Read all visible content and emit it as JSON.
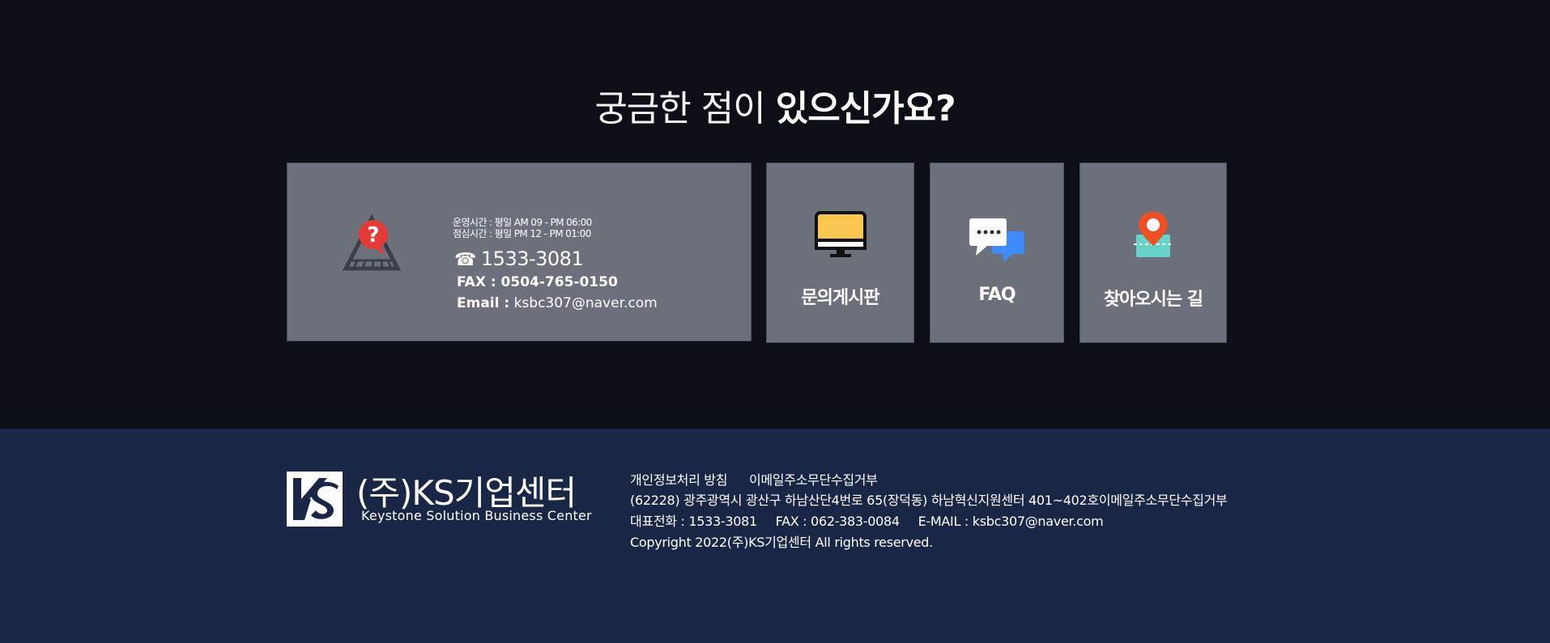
{
  "headline": {
    "light": "궁금한 점이",
    "bold": "있으신가요?"
  },
  "info": {
    "hours_line1": "운영시간 : 평일  AM 09 - PM 06:00",
    "hours_line2": "점심시간 : 평일  PM 12 - PM 01:00",
    "phone_glyph": "☎",
    "phone": "1533-3081",
    "fax": "FAX : 0504-765-0150",
    "email_label": "Email :",
    "email": "ksbc307@naver.com"
  },
  "tiles": {
    "board": "문의게시판",
    "faq": "FAQ",
    "directions": "찾아오시는 길"
  },
  "footer": {
    "company_name": "(주)KS기업센터",
    "company_sub": "Keystone Solution Business Center",
    "link_privacy": "개인정보처리 방침",
    "link_email_refuse": "이메일주소무단수집거부",
    "address": "(62228) 광주광역시 광산구 하남산단4번로 65(장덕동) 하남혁신지원센터 401~402호이메일주소무단수집거부",
    "phone": "대표전화 : 1533-3081",
    "fax": "FAX : 062-383-0084",
    "email": "E-MAIL : ksbc307@naver.com",
    "copyright": "Copyright 2022(주)KS기업센터 All rights reserved."
  },
  "colors": {
    "page_bg": "#0c1016",
    "card_bg": "#6b707b",
    "footer_bg": "#1a2645"
  }
}
